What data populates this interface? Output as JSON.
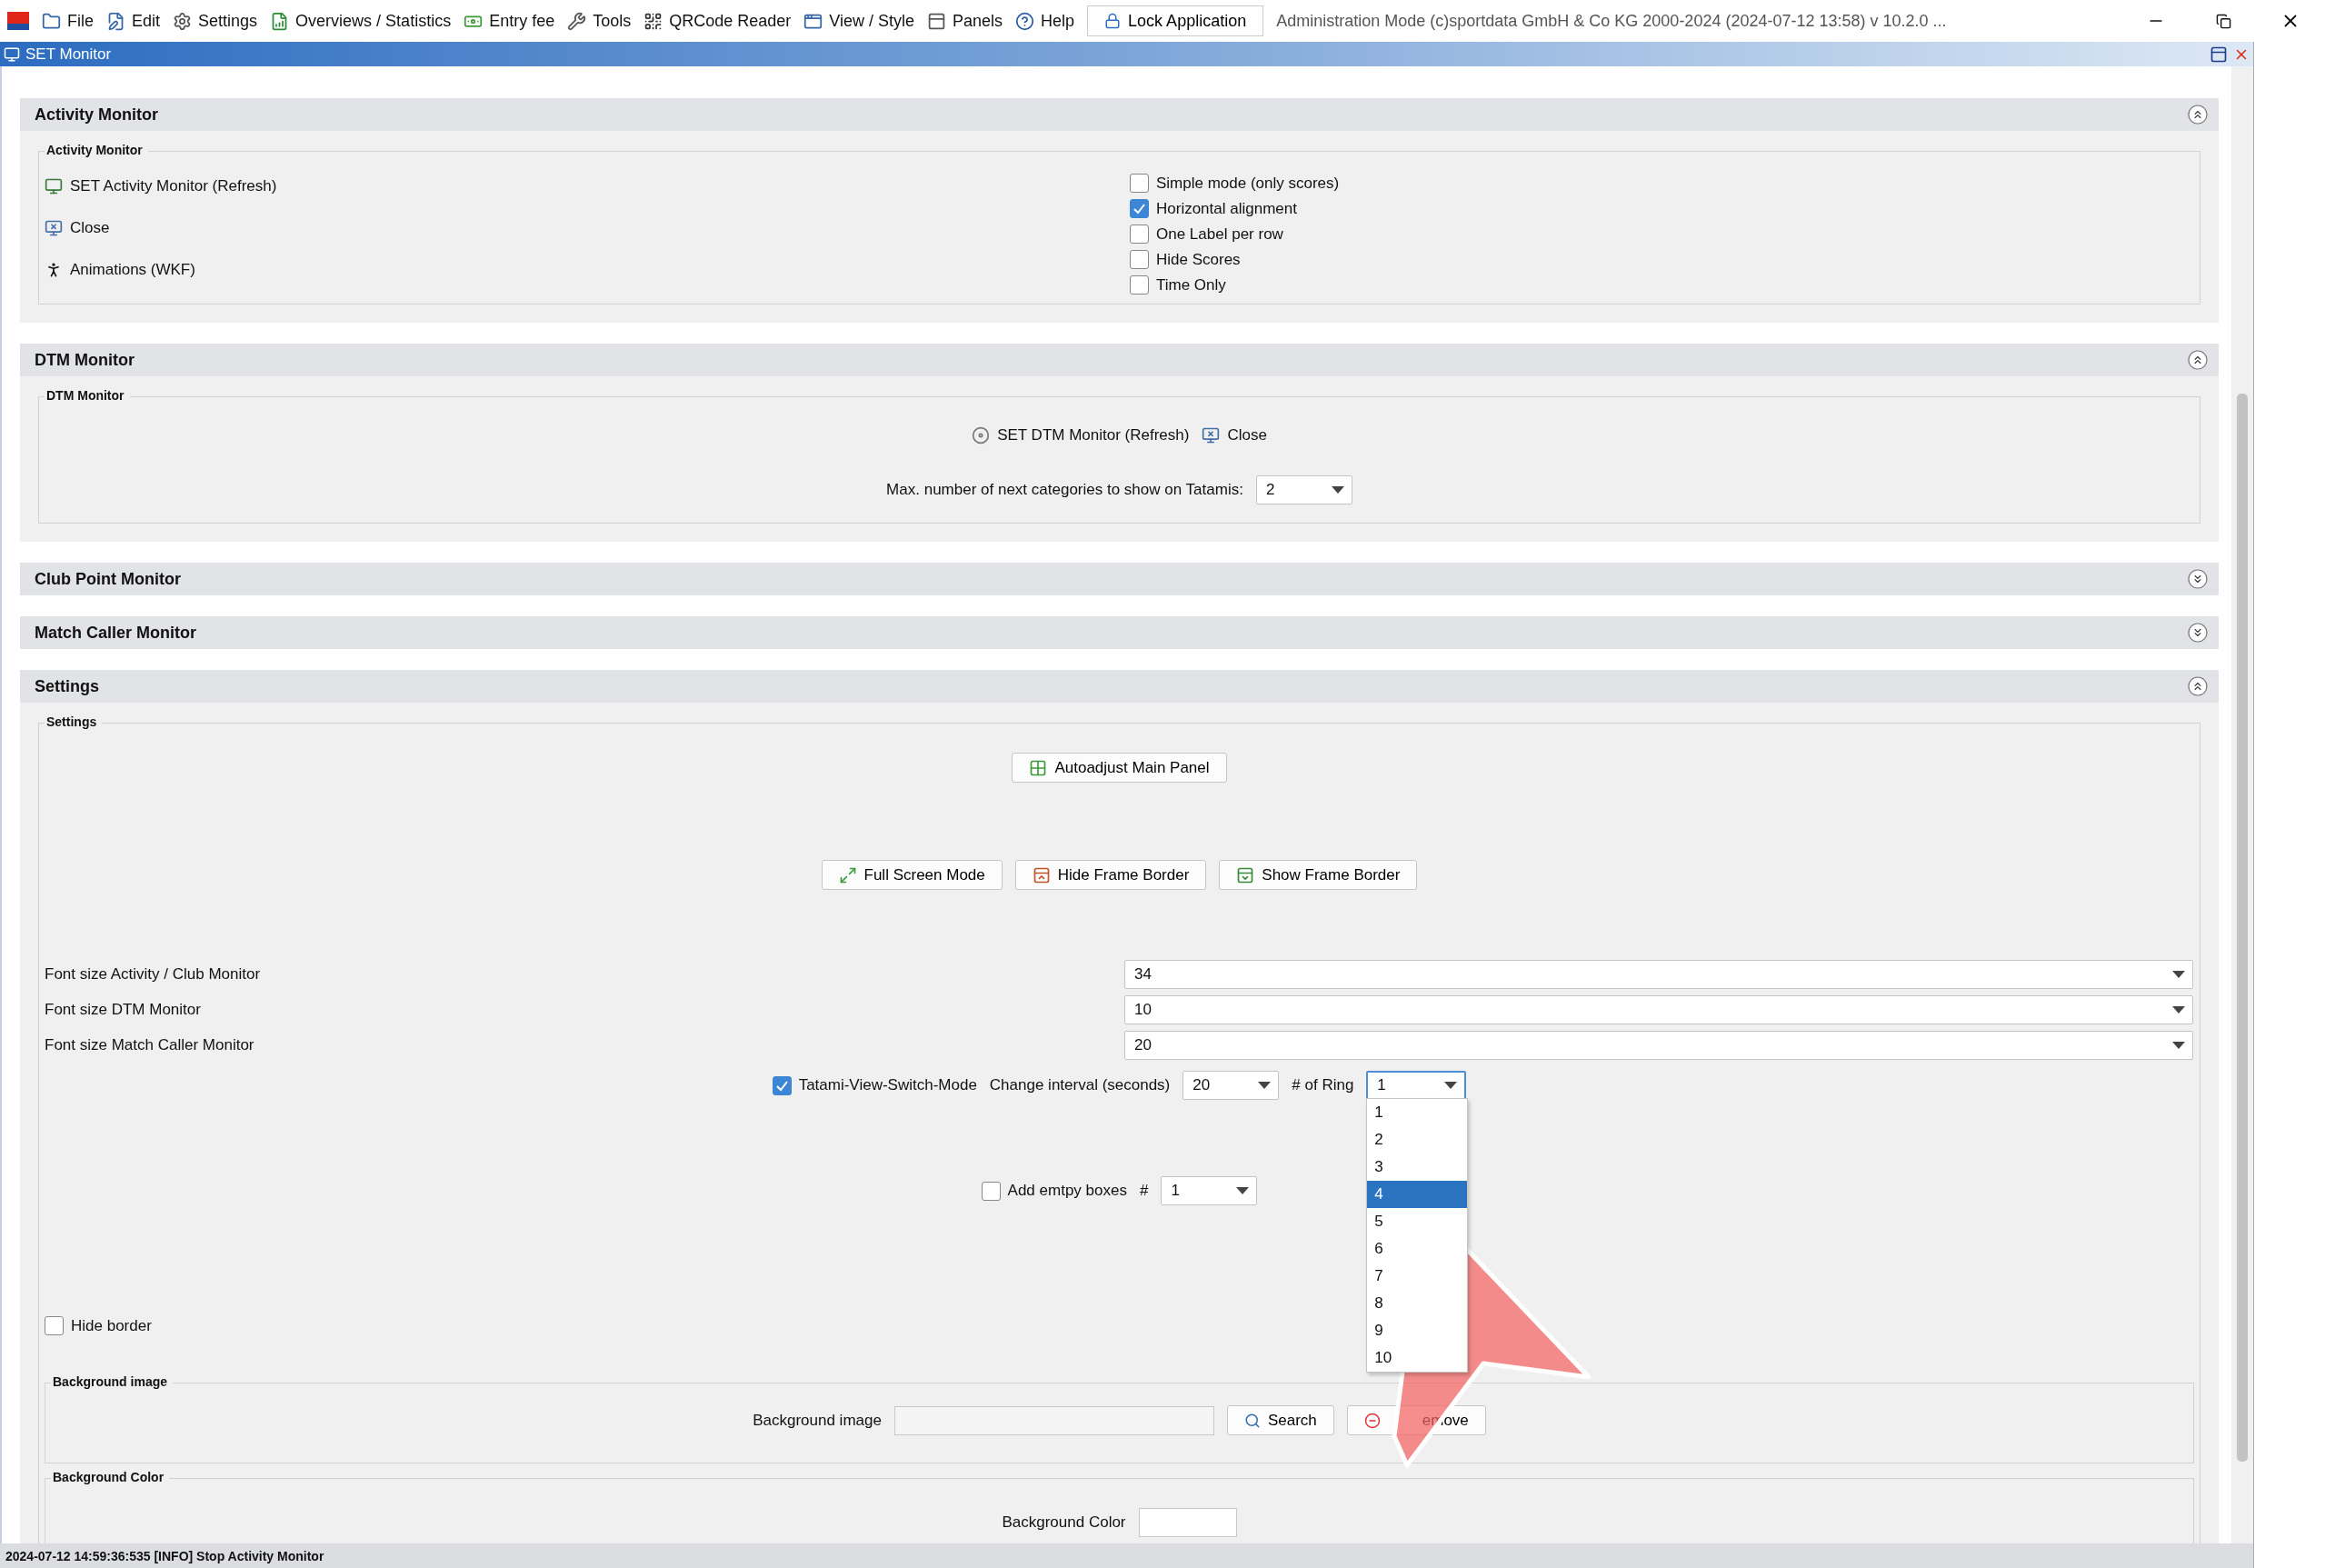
{
  "menu_bar": {
    "items": [
      {
        "label": "File"
      },
      {
        "label": "Edit"
      },
      {
        "label": "Settings"
      },
      {
        "label": "Overviews / Statistics"
      },
      {
        "label": "Entry fee"
      },
      {
        "label": "Tools"
      },
      {
        "label": "QRCode Reader"
      },
      {
        "label": "View / Style"
      },
      {
        "label": "Panels"
      },
      {
        "label": "Help"
      }
    ],
    "lock_button": "Lock Application",
    "info": "Administration Mode (c)sportdata GmbH & Co KG 2000-2024 (2024-07-12 13:58)  v 10.2.0 ..."
  },
  "window": {
    "title": "SET Monitor"
  },
  "sections": [
    {
      "kind": "activity",
      "title": "Activity Monitor",
      "expanded": true,
      "group_title": "Activity Monitor",
      "actions": [
        "SET Activity Monitor (Refresh)",
        "Close",
        "Animations (WKF)"
      ],
      "options": [
        {
          "label": "Simple mode (only scores)",
          "checked": false
        },
        {
          "label": "Horizontal alignment",
          "checked": true
        },
        {
          "label": "One Label per row",
          "checked": false
        },
        {
          "label": "Hide Scores",
          "checked": false
        },
        {
          "label": "Time Only",
          "checked": false
        }
      ]
    },
    {
      "kind": "dtm",
      "title": "DTM Monitor",
      "expanded": true,
      "group_title": "DTM Monitor",
      "actions": [
        "SET DTM Monitor (Refresh)",
        "Close"
      ],
      "max_label": "Max. number of next categories to show on Tatamis:",
      "max_value": "2"
    },
    {
      "title": "Club Point Monitor",
      "expanded": false
    },
    {
      "title": "Match Caller Monitor",
      "expanded": false
    },
    {
      "kind": "settings",
      "title": "Settings",
      "expanded": true,
      "group_title": "Settings",
      "autoadjust": "Autoadjust Main Panel",
      "frame_buttons": [
        "Full Screen Mode",
        "Hide Frame Border",
        "Show Frame Border"
      ],
      "font_sizes": [
        {
          "label": "Font size Activity / Club Monitor",
          "value": "34"
        },
        {
          "label": "Font size DTM Monitor",
          "value": "10"
        },
        {
          "label": "Font size Match Caller Monitor",
          "value": "20"
        }
      ],
      "tatami": {
        "label": "Tatami-View-Switch-Mode",
        "checked": true,
        "interval_label": "Change interval (seconds)",
        "interval": "20",
        "ring_label": "# of Ring",
        "ring": "1",
        "ring_options": [
          {
            "label": "1",
            "selected": false
          },
          {
            "label": "2",
            "selected": false
          },
          {
            "label": "3",
            "selected": false
          },
          {
            "label": "4",
            "selected": true
          },
          {
            "label": "5",
            "selected": false
          },
          {
            "label": "6",
            "selected": false
          },
          {
            "label": "7",
            "selected": false
          },
          {
            "label": "8",
            "selected": false
          },
          {
            "label": "9",
            "selected": false
          },
          {
            "label": "10",
            "selected": false
          }
        ]
      },
      "empty_boxes": {
        "label": "Add emtpy boxes",
        "checked": false,
        "count_label": "#",
        "count": "1"
      },
      "hide_border": {
        "label": "Hide border",
        "checked": false
      },
      "background_image": {
        "group_title": "Background image",
        "label": "Background image",
        "search": "Search",
        "remove": "emove"
      },
      "background_color": {
        "group_title": "Background Color",
        "label": "Background Color"
      }
    }
  ],
  "status_bar": "2024-07-12 14:59:36:535 [INFO] Stop Activity Monitor"
}
